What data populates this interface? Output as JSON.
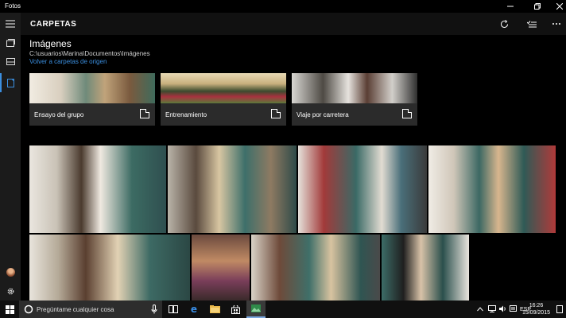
{
  "window": {
    "app_title": "Fotos"
  },
  "header": {
    "section_title": "CARPETAS"
  },
  "folder": {
    "title": "Imágenes",
    "path": "C:\\usuarios\\Marina\\Documentos\\Imágenes",
    "back_link": "Volver a carpetas de origen"
  },
  "subfolders": [
    {
      "label": "Ensayo del grupo"
    },
    {
      "label": "Entrenamiento"
    },
    {
      "label": "Viaje por carretera"
    }
  ],
  "taskbar": {
    "search_placeholder": "Pregúntame cualquier cosa",
    "language": "ESP",
    "time": "16:26",
    "date": "15/09/2015"
  },
  "icons": {
    "rail": [
      "hamburger-menu-icon",
      "collection-icon",
      "albums-icon",
      "folders-icon",
      "account-avatar-icon",
      "settings-gear-icon"
    ],
    "header": [
      "refresh-icon",
      "select-icon",
      "more-icon"
    ],
    "taskbar": [
      "windows-start-icon",
      "microphone-icon",
      "task-view-icon",
      "edge-icon",
      "file-explorer-icon",
      "store-icon",
      "photos-app-icon"
    ]
  },
  "colors": {
    "accent_link": "#3b8fe0",
    "rail_background": "#1b1b1b",
    "taskbar_background": "#101010"
  }
}
